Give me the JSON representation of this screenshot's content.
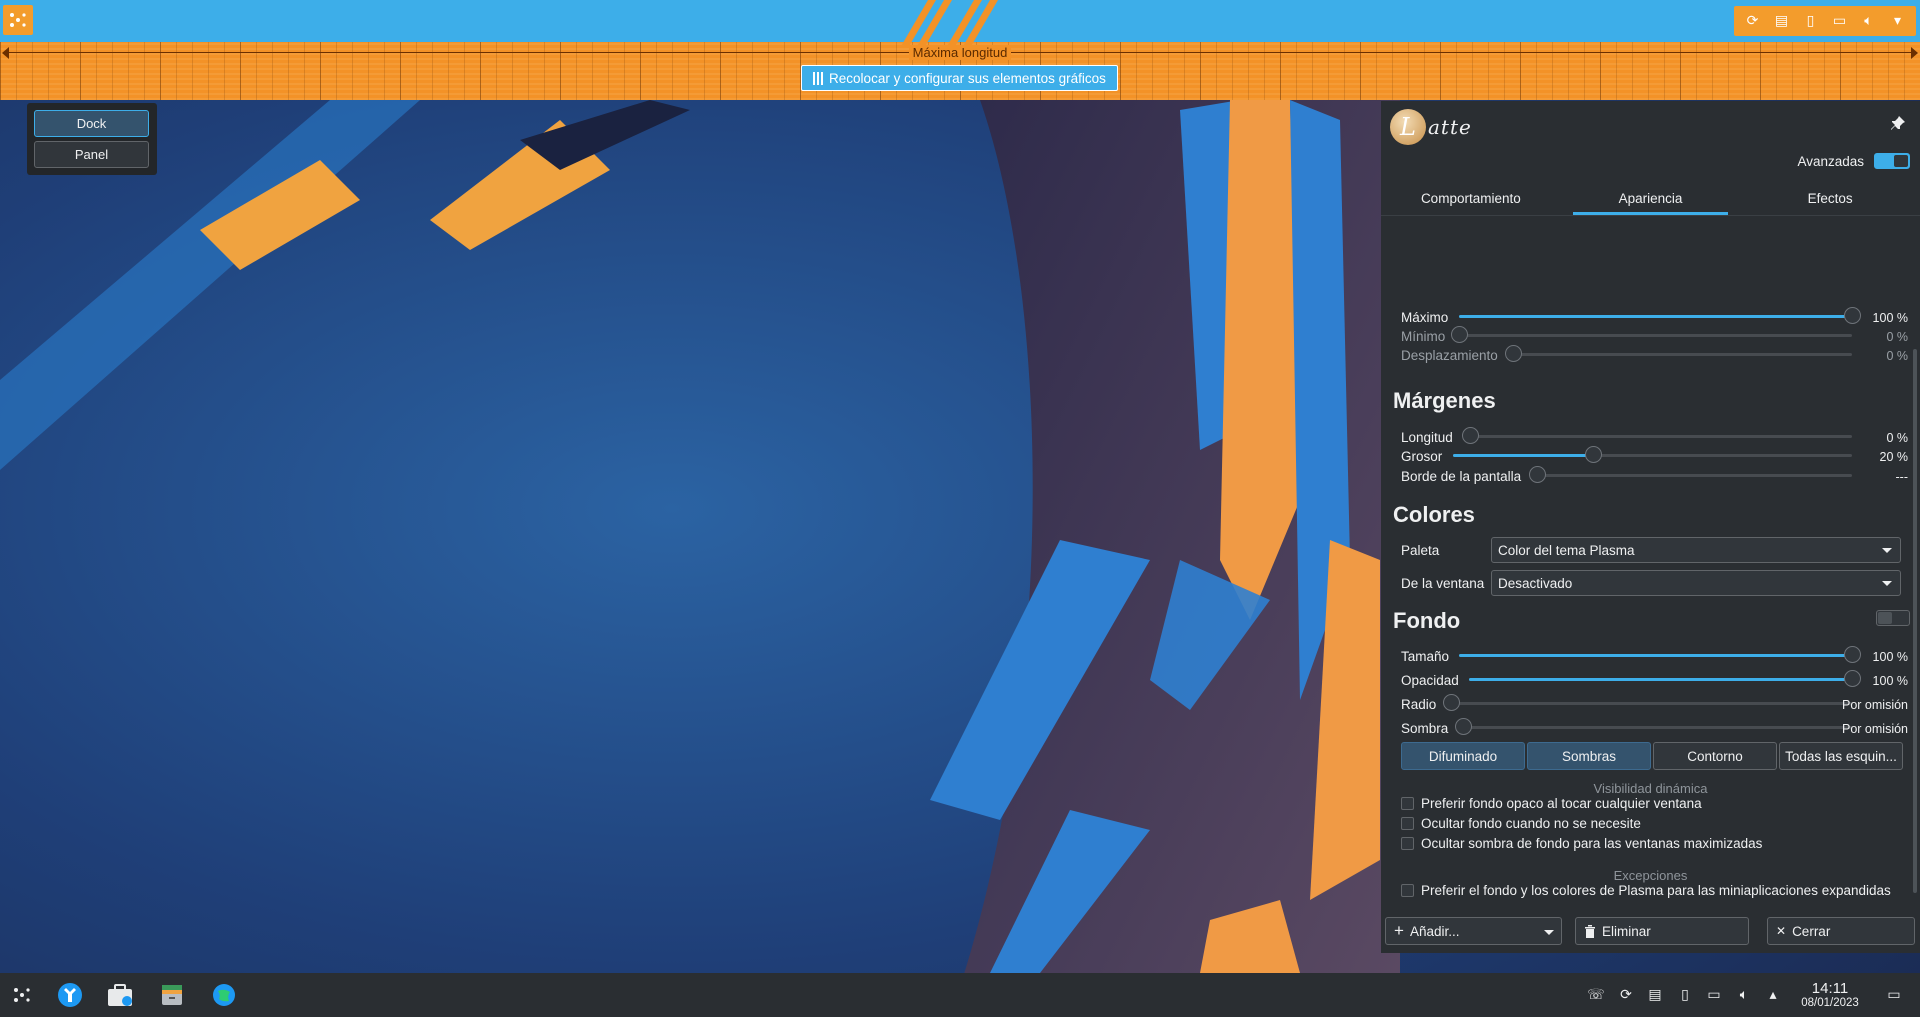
{
  "top_dock": {
    "launcher_icon": "kde-application-launcher-icon",
    "tray_icons": [
      "update-icon",
      "clipboard-icon",
      "removable-device-icon",
      "display-icon",
      "volume-icon",
      "expand-arrow-icon"
    ]
  },
  "ruler": {
    "label": "Máxima longitud"
  },
  "rearrange_button": {
    "label": "Recolocar y configurar sus elementos gráficos"
  },
  "type_chooser": {
    "options": [
      {
        "label": "Dock",
        "active": true
      },
      {
        "label": "Panel",
        "active": false
      }
    ]
  },
  "settings": {
    "logo_text": "atte",
    "logo_letter": "L",
    "advanced_label": "Avanzadas",
    "advanced_enabled": true,
    "tabs": [
      {
        "label": "Comportamiento",
        "active": false
      },
      {
        "label": "Apariencia",
        "active": true
      },
      {
        "label": "Efectos",
        "active": false
      }
    ],
    "length": {
      "rows": [
        {
          "label": "Máximo",
          "value": "100 %",
          "level": 100,
          "enabled": true
        },
        {
          "label": "Mínimo",
          "value": "0 %",
          "level": 0,
          "enabled": false
        },
        {
          "label": "Desplazamiento",
          "value": "0 %",
          "level": 0,
          "enabled": false
        }
      ]
    },
    "margins": {
      "title": "Márgenes",
      "rows": [
        {
          "label": "Longitud",
          "value": "0 %",
          "level": 0,
          "enabled": true
        },
        {
          "label": "Grosor",
          "value": "20 %",
          "level": 35,
          "enabled": true
        },
        {
          "label": "Borde de la pantalla",
          "value": "---",
          "level": 0,
          "enabled": true
        }
      ]
    },
    "colors": {
      "title": "Colores",
      "palette_label": "Paleta",
      "palette_value": "Color del tema Plasma",
      "window_label": "De la ventana",
      "window_value": "Desactivado"
    },
    "background": {
      "title": "Fondo",
      "enabled": false,
      "rows": [
        {
          "label": "Tamaño",
          "value": "100 %",
          "level": 100,
          "enabled": true
        },
        {
          "label": "Opacidad",
          "value": "100 %",
          "level": 100,
          "enabled": true
        },
        {
          "label": "Radio",
          "value": "Por omisión",
          "level": 0,
          "enabled": true
        },
        {
          "label": "Sombra",
          "value": "Por omisión",
          "level": 0,
          "enabled": true
        }
      ],
      "style_buttons": [
        {
          "label": "Difuminado",
          "checked": true
        },
        {
          "label": "Sombras",
          "checked": true
        },
        {
          "label": "Contorno",
          "checked": false
        },
        {
          "label": "Todas las esquin...",
          "checked": false
        }
      ],
      "dynamic_heading": "Visibilidad dinámica",
      "dynamic_checks": [
        {
          "label": "Preferir fondo opaco al tocar cualquier ventana",
          "checked": false
        },
        {
          "label": "Ocultar fondo cuando no se necesite",
          "checked": false
        },
        {
          "label": "Ocultar sombra de fondo para las ventanas maximizadas",
          "checked": false
        }
      ],
      "exceptions_heading": "Excepciones",
      "exception_checks": [
        {
          "label": "Preferir el fondo y los colores de Plasma para las miniaplicaciones expandidas",
          "checked": false
        }
      ]
    },
    "footer": {
      "add_label": "Añadir...",
      "remove_label": "Eliminar",
      "close_label": "Cerrar"
    }
  },
  "taskbar": {
    "apps": [
      "kde-launcher-icon",
      "system-settings-wrench-icon",
      "discover-store-icon",
      "file-manager-icon",
      "web-browser-icon"
    ],
    "tray": [
      "kde-connect-icon",
      "update-icon",
      "clipboard-icon",
      "removable-device-icon",
      "display-icon",
      "volume-icon",
      "expand-arrow-icon"
    ],
    "clock_time": "14:11",
    "clock_date": "08/01/2023",
    "show_desktop_icon": "show-desktop-icon"
  },
  "colors": {
    "accent": "#3daee9",
    "panel_bg": "#2a2e32",
    "ruler_orange": "#f39227"
  }
}
